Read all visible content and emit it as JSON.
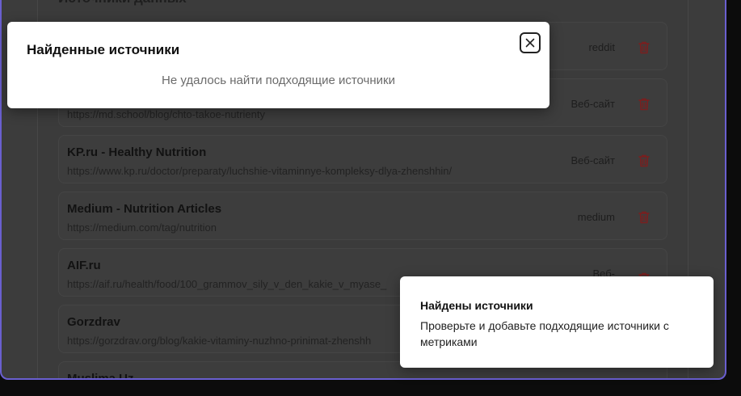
{
  "section_title": "Источники данных",
  "sources": [
    {
      "name": "",
      "url": "",
      "type": "reddit"
    },
    {
      "name": "",
      "url": "https://md.school/blog/chto-takoe-nutrienty",
      "type": "Веб-сайт"
    },
    {
      "name": "KP.ru - Healthy Nutrition",
      "url": "https://www.kp.ru/doctor/preparaty/luchshie-vitaminnye-kompleksy-dlya-zhenshhin/",
      "type": "Веб-сайт"
    },
    {
      "name": "Medium - Nutrition Articles",
      "url": "https://medium.com/tag/nutrition",
      "type": "medium"
    },
    {
      "name": "AIF.ru",
      "url": "https://aif.ru/health/food/100_grammov_sily_v_den_kakie_v_myase_",
      "type": "Веб-"
    },
    {
      "name": "Gorzdrav",
      "url": "https://gorzdrav.org/blog/kakie-vitaminy-nuzhno-prinimat-zhenshh",
      "type": ""
    },
    {
      "name": "Muslima.Uz",
      "url": "",
      "type": ""
    }
  ],
  "modal": {
    "title": "Найденные источники",
    "message": "Не удалось найти подходящие источники"
  },
  "toast": {
    "title": "Найдены источники",
    "text": "Проверьте и добавьте подходящие источники с метриками"
  },
  "colors": {
    "accent_border": "#6a5fd0",
    "delete_icon": "#c62828",
    "overlay": "#3c3c3c"
  }
}
